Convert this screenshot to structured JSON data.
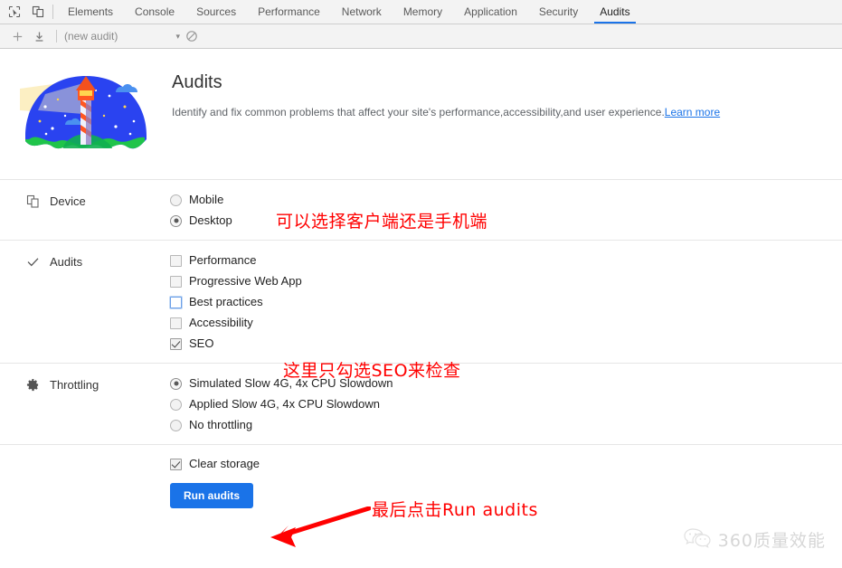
{
  "devtools": {
    "icons": {
      "inspect": "inspect-element-icon",
      "device_toolbar": "device-toolbar-icon"
    },
    "tabs": [
      {
        "label": "Elements",
        "active": false
      },
      {
        "label": "Console",
        "active": false
      },
      {
        "label": "Sources",
        "active": false
      },
      {
        "label": "Performance",
        "active": false
      },
      {
        "label": "Network",
        "active": false
      },
      {
        "label": "Memory",
        "active": false
      },
      {
        "label": "Application",
        "active": false
      },
      {
        "label": "Security",
        "active": false
      },
      {
        "label": "Audits",
        "active": true
      }
    ],
    "toolbar": {
      "add_label": "+",
      "import_icon": "download-icon",
      "audit_select_value": "(new audit)",
      "caret": "▾",
      "clear_icon": "no-entry-icon"
    },
    "accent_color": "#1a73e8"
  },
  "hero": {
    "logo_icon": "lighthouse-logo",
    "title": "Audits",
    "description": "Identify and fix common problems that affect your site's performance,accessibility,and user experience.",
    "learn_more": "Learn more"
  },
  "device_section": {
    "icon": "device-icon",
    "title": "Device",
    "options": [
      {
        "label": "Mobile",
        "selected": false
      },
      {
        "label": "Desktop",
        "selected": true
      }
    ]
  },
  "audits_section": {
    "icon": "checkmark-icon",
    "title": "Audits",
    "options": [
      {
        "label": "Performance",
        "checked": false,
        "focused": false
      },
      {
        "label": "Progressive Web App",
        "checked": false,
        "focused": false
      },
      {
        "label": "Best practices",
        "checked": false,
        "focused": true
      },
      {
        "label": "Accessibility",
        "checked": false,
        "focused": false
      },
      {
        "label": "SEO",
        "checked": true,
        "focused": false
      }
    ]
  },
  "throttling_section": {
    "icon": "gear-icon",
    "title": "Throttling",
    "options": [
      {
        "label": "Simulated Slow 4G, 4x CPU Slowdown",
        "selected": true
      },
      {
        "label": "Applied Slow 4G, 4x CPU Slowdown",
        "selected": false
      },
      {
        "label": "No throttling",
        "selected": false
      }
    ]
  },
  "footer_section": {
    "clear_storage": {
      "label": "Clear storage",
      "checked": true
    },
    "run_button": "Run audits"
  },
  "annotations": {
    "color": "#ff0000",
    "device_note": "可以选择客户端还是手机端",
    "seo_note": "这里只勾选SEO来检查",
    "run_note": "最后点击Run audits",
    "arrow_icon": "red-arrow-icon"
  },
  "watermark": {
    "icon": "wechat-icon",
    "text": "360质量效能"
  }
}
